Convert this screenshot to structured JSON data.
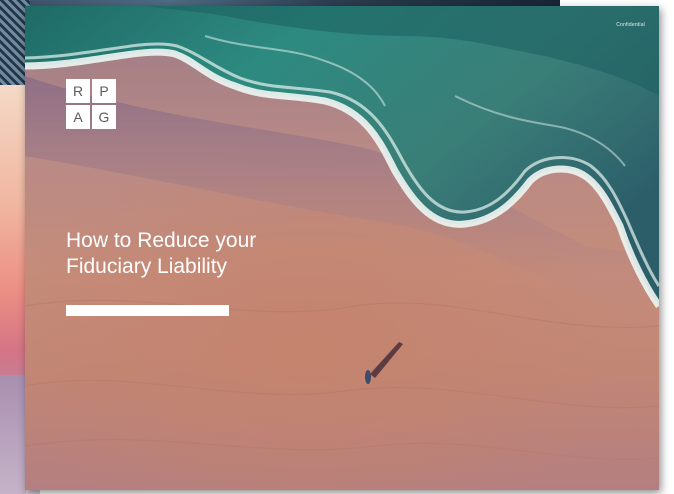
{
  "document": {
    "confidential_label": "Confidential",
    "logo": {
      "letters": [
        "R",
        "P",
        "A",
        "G"
      ]
    },
    "title_lines": [
      "How to Reduce your",
      "Fiduciary Liability"
    ]
  },
  "colors": {
    "sand": "#c58c7a",
    "sea": "#2e7a72",
    "foam": "#e8f2ee",
    "title_text": "#ffffff",
    "logo_text": "#5b5b5b"
  }
}
